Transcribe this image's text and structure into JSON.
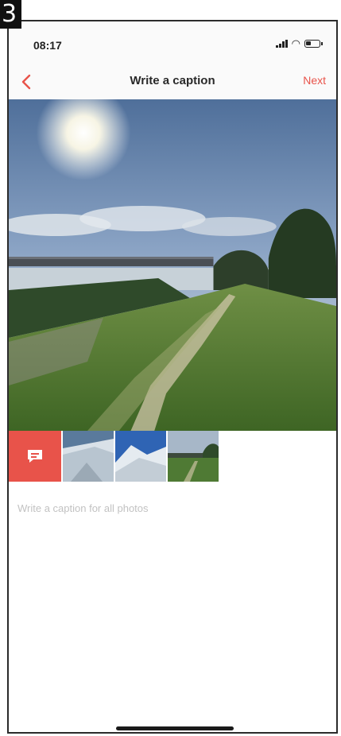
{
  "panel": {
    "tag": "3"
  },
  "status_bar": {
    "time": "08:17",
    "signal_icon": "cellular-signal-icon",
    "wifi_icon": "wifi-icon",
    "battery_icon": "battery-icon"
  },
  "nav": {
    "back_icon": "chevron-left-icon",
    "title": "Write a caption",
    "next_label": "Next"
  },
  "accent_color": "#e8534a",
  "main_photo": {
    "subject": "riverside-embankment-path-photo"
  },
  "thumbnails": [
    {
      "name": "snowy-slope-photo"
    },
    {
      "name": "snowy-hill-blue-sky-photo"
    },
    {
      "name": "riverside-path-photo"
    }
  ],
  "caption_toggle_icon": "speech-bubble-icon",
  "caption": {
    "placeholder": "Write a caption for all photos",
    "value": ""
  }
}
